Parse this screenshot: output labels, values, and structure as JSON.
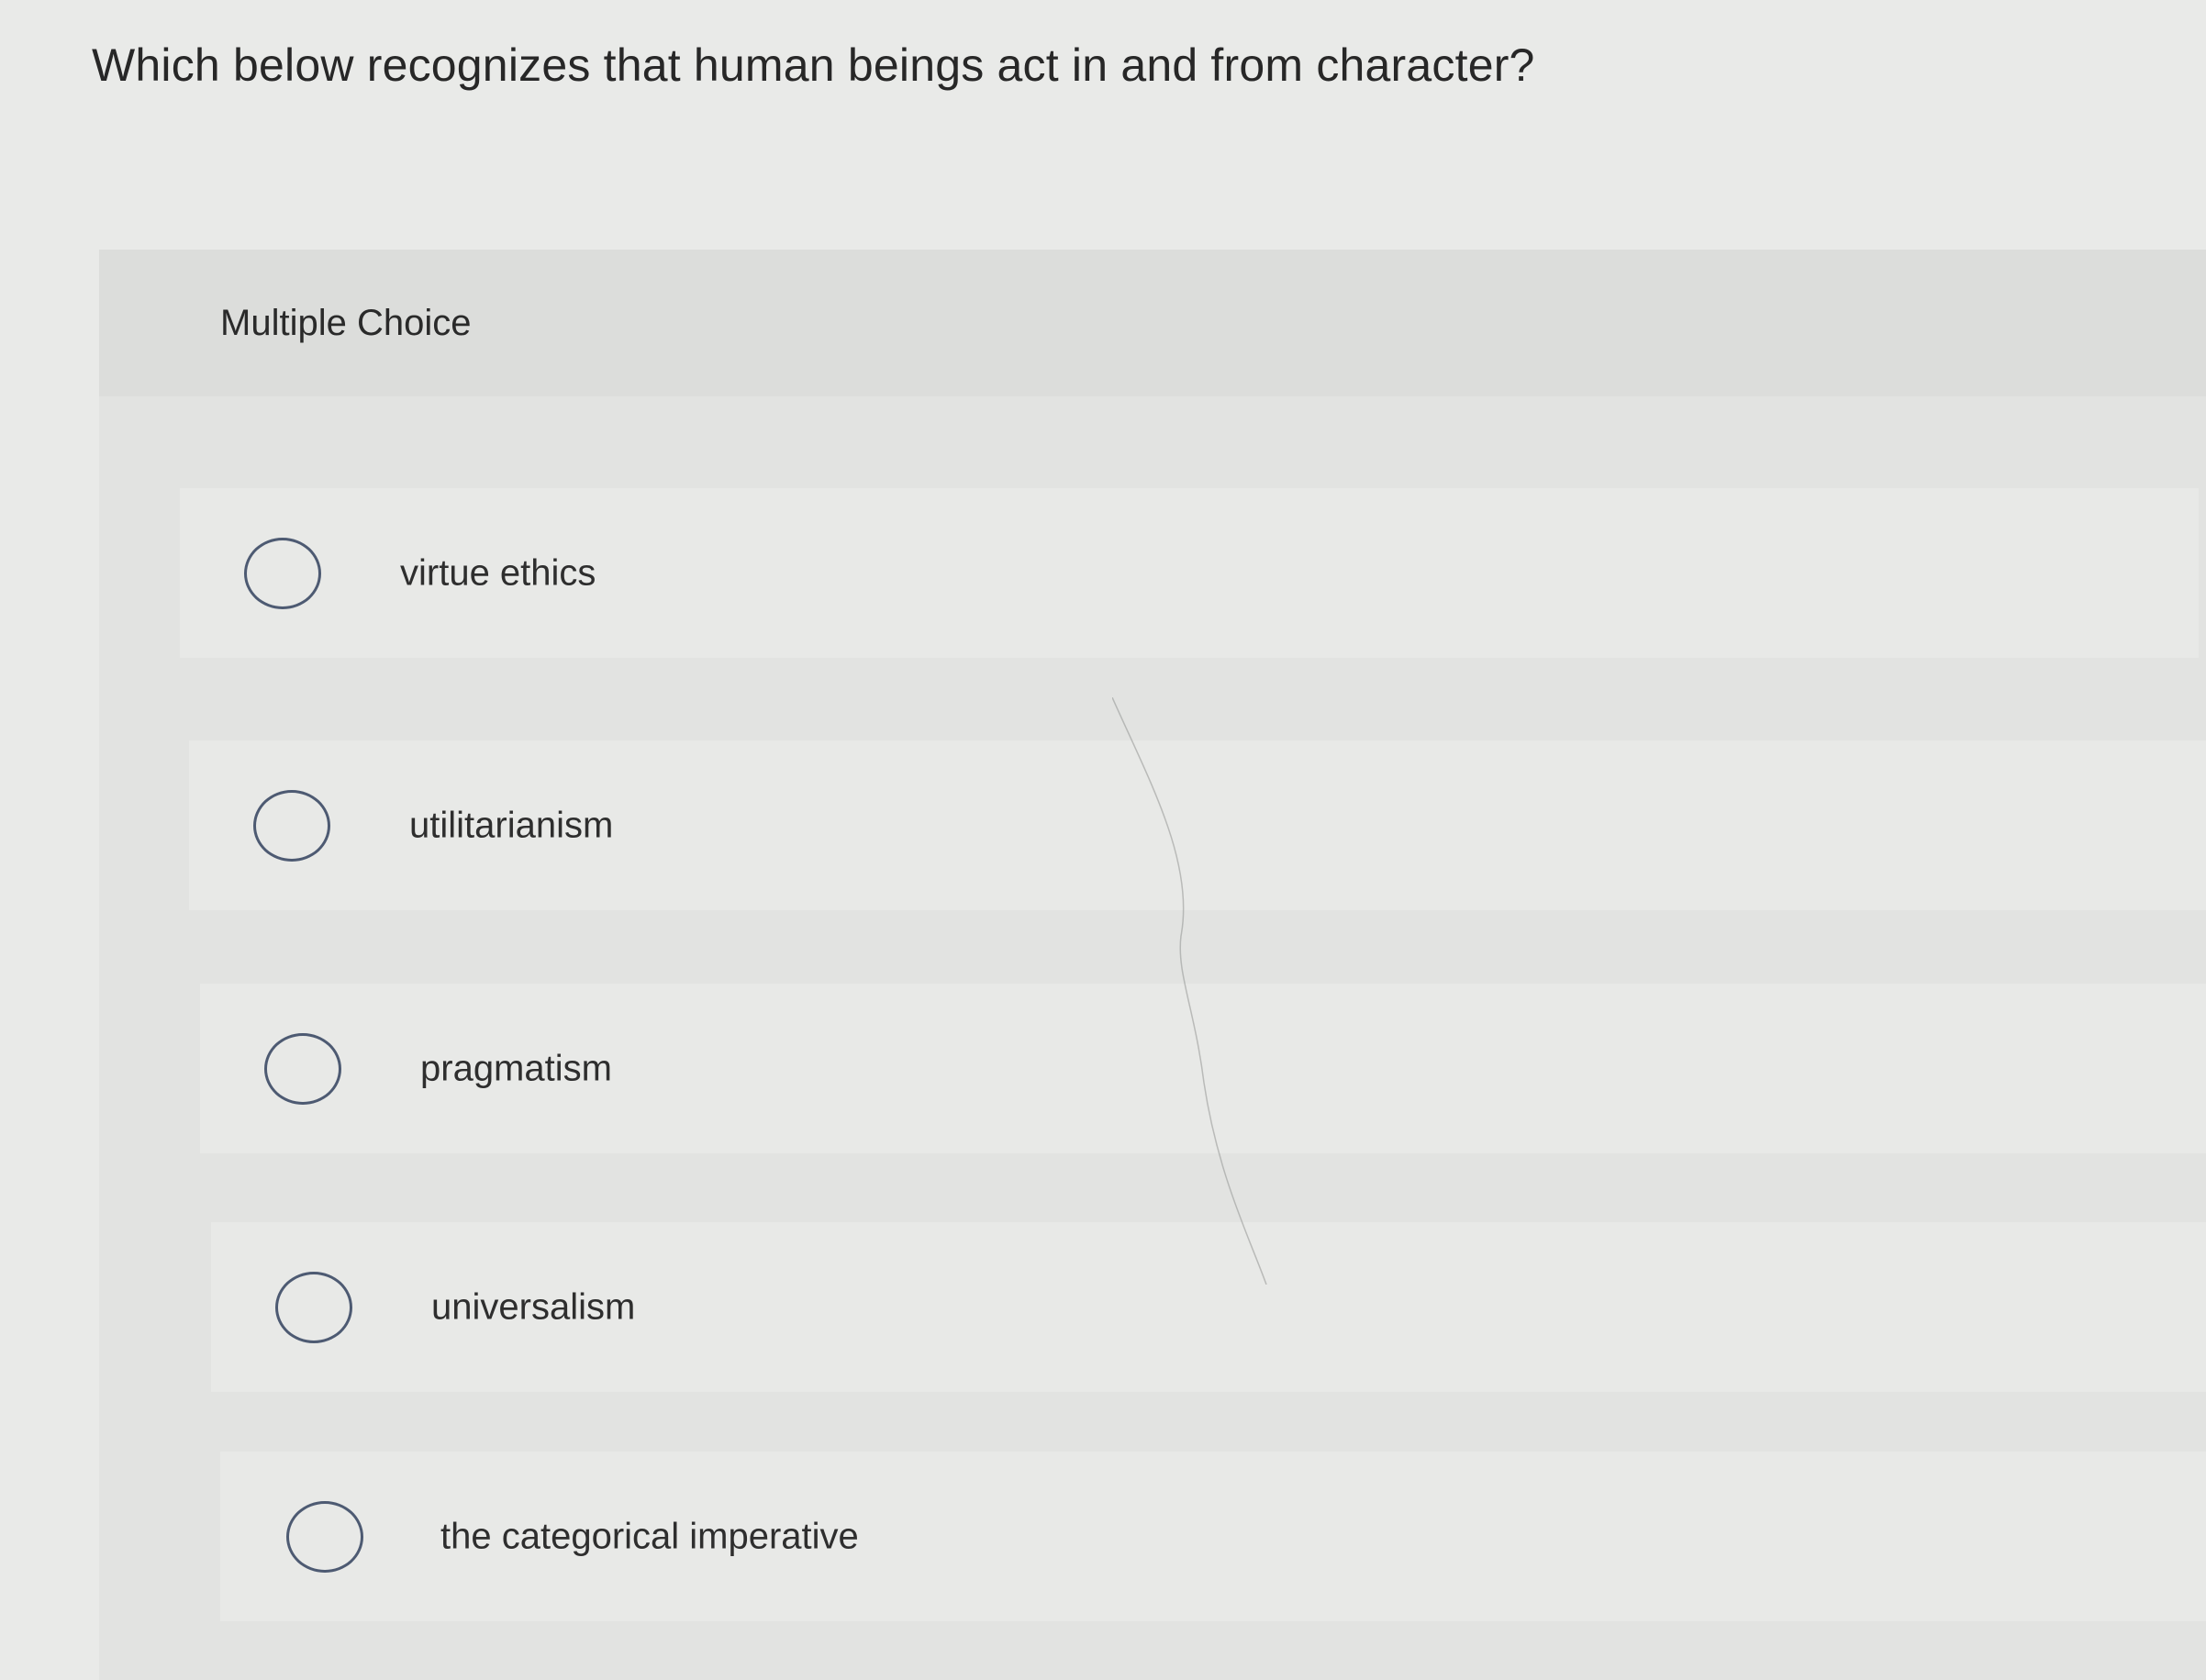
{
  "question": {
    "text": "Which below recognizes that human beings act in and from character?"
  },
  "panel": {
    "type_label": "Multiple Choice"
  },
  "options": [
    {
      "label": "virtue ethics",
      "selected": false
    },
    {
      "label": "utilitarianism",
      "selected": false
    },
    {
      "label": "pragmatism",
      "selected": false
    },
    {
      "label": "universalism",
      "selected": false
    },
    {
      "label": "the categorical imperative",
      "selected": false
    }
  ],
  "colors": {
    "page_background": "#e9eae8",
    "panel_background": "#e2e3e1",
    "radio_border": "#4d5a72",
    "text": "#2c2c2c"
  }
}
